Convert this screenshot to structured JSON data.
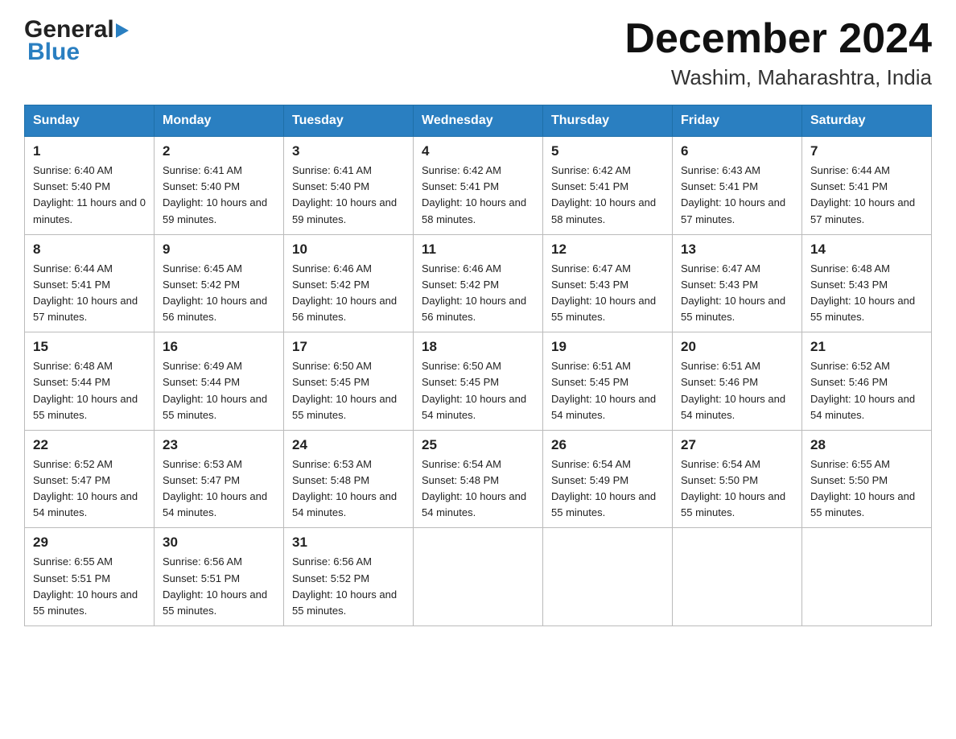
{
  "header": {
    "logo_general": "General",
    "logo_blue": "Blue",
    "month_title": "December 2024",
    "location": "Washim, Maharashtra, India"
  },
  "days_of_week": [
    "Sunday",
    "Monday",
    "Tuesday",
    "Wednesday",
    "Thursday",
    "Friday",
    "Saturday"
  ],
  "weeks": [
    [
      {
        "day": "1",
        "sunrise": "6:40 AM",
        "sunset": "5:40 PM",
        "daylight": "11 hours and 0 minutes."
      },
      {
        "day": "2",
        "sunrise": "6:41 AM",
        "sunset": "5:40 PM",
        "daylight": "10 hours and 59 minutes."
      },
      {
        "day": "3",
        "sunrise": "6:41 AM",
        "sunset": "5:40 PM",
        "daylight": "10 hours and 59 minutes."
      },
      {
        "day": "4",
        "sunrise": "6:42 AM",
        "sunset": "5:41 PM",
        "daylight": "10 hours and 58 minutes."
      },
      {
        "day": "5",
        "sunrise": "6:42 AM",
        "sunset": "5:41 PM",
        "daylight": "10 hours and 58 minutes."
      },
      {
        "day": "6",
        "sunrise": "6:43 AM",
        "sunset": "5:41 PM",
        "daylight": "10 hours and 57 minutes."
      },
      {
        "day": "7",
        "sunrise": "6:44 AM",
        "sunset": "5:41 PM",
        "daylight": "10 hours and 57 minutes."
      }
    ],
    [
      {
        "day": "8",
        "sunrise": "6:44 AM",
        "sunset": "5:41 PM",
        "daylight": "10 hours and 57 minutes."
      },
      {
        "day": "9",
        "sunrise": "6:45 AM",
        "sunset": "5:42 PM",
        "daylight": "10 hours and 56 minutes."
      },
      {
        "day": "10",
        "sunrise": "6:46 AM",
        "sunset": "5:42 PM",
        "daylight": "10 hours and 56 minutes."
      },
      {
        "day": "11",
        "sunrise": "6:46 AM",
        "sunset": "5:42 PM",
        "daylight": "10 hours and 56 minutes."
      },
      {
        "day": "12",
        "sunrise": "6:47 AM",
        "sunset": "5:43 PM",
        "daylight": "10 hours and 55 minutes."
      },
      {
        "day": "13",
        "sunrise": "6:47 AM",
        "sunset": "5:43 PM",
        "daylight": "10 hours and 55 minutes."
      },
      {
        "day": "14",
        "sunrise": "6:48 AM",
        "sunset": "5:43 PM",
        "daylight": "10 hours and 55 minutes."
      }
    ],
    [
      {
        "day": "15",
        "sunrise": "6:48 AM",
        "sunset": "5:44 PM",
        "daylight": "10 hours and 55 minutes."
      },
      {
        "day": "16",
        "sunrise": "6:49 AM",
        "sunset": "5:44 PM",
        "daylight": "10 hours and 55 minutes."
      },
      {
        "day": "17",
        "sunrise": "6:50 AM",
        "sunset": "5:45 PM",
        "daylight": "10 hours and 55 minutes."
      },
      {
        "day": "18",
        "sunrise": "6:50 AM",
        "sunset": "5:45 PM",
        "daylight": "10 hours and 54 minutes."
      },
      {
        "day": "19",
        "sunrise": "6:51 AM",
        "sunset": "5:45 PM",
        "daylight": "10 hours and 54 minutes."
      },
      {
        "day": "20",
        "sunrise": "6:51 AM",
        "sunset": "5:46 PM",
        "daylight": "10 hours and 54 minutes."
      },
      {
        "day": "21",
        "sunrise": "6:52 AM",
        "sunset": "5:46 PM",
        "daylight": "10 hours and 54 minutes."
      }
    ],
    [
      {
        "day": "22",
        "sunrise": "6:52 AM",
        "sunset": "5:47 PM",
        "daylight": "10 hours and 54 minutes."
      },
      {
        "day": "23",
        "sunrise": "6:53 AM",
        "sunset": "5:47 PM",
        "daylight": "10 hours and 54 minutes."
      },
      {
        "day": "24",
        "sunrise": "6:53 AM",
        "sunset": "5:48 PM",
        "daylight": "10 hours and 54 minutes."
      },
      {
        "day": "25",
        "sunrise": "6:54 AM",
        "sunset": "5:48 PM",
        "daylight": "10 hours and 54 minutes."
      },
      {
        "day": "26",
        "sunrise": "6:54 AM",
        "sunset": "5:49 PM",
        "daylight": "10 hours and 55 minutes."
      },
      {
        "day": "27",
        "sunrise": "6:54 AM",
        "sunset": "5:50 PM",
        "daylight": "10 hours and 55 minutes."
      },
      {
        "day": "28",
        "sunrise": "6:55 AM",
        "sunset": "5:50 PM",
        "daylight": "10 hours and 55 minutes."
      }
    ],
    [
      {
        "day": "29",
        "sunrise": "6:55 AM",
        "sunset": "5:51 PM",
        "daylight": "10 hours and 55 minutes."
      },
      {
        "day": "30",
        "sunrise": "6:56 AM",
        "sunset": "5:51 PM",
        "daylight": "10 hours and 55 minutes."
      },
      {
        "day": "31",
        "sunrise": "6:56 AM",
        "sunset": "5:52 PM",
        "daylight": "10 hours and 55 minutes."
      },
      null,
      null,
      null,
      null
    ]
  ],
  "labels": {
    "sunrise": "Sunrise:",
    "sunset": "Sunset:",
    "daylight": "Daylight:"
  }
}
